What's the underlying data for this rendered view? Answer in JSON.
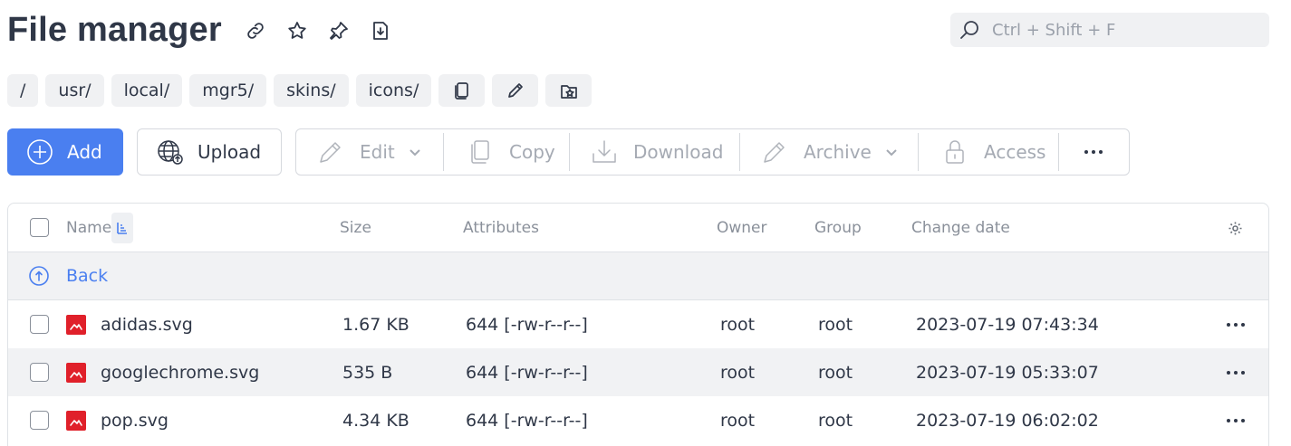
{
  "header": {
    "title": "File manager",
    "icons": [
      "link-icon",
      "star-icon",
      "pin-icon",
      "save-download-icon"
    ]
  },
  "search": {
    "placeholder": "Ctrl + Shift + F",
    "icon": "search-icon"
  },
  "breadcrumbs": [
    "/",
    "usr/",
    "local/",
    "mgr5/",
    "skins/",
    "icons/"
  ],
  "breadcrumb_actions": [
    "copy-path-icon",
    "edit-path-icon",
    "favorite-folder-icon"
  ],
  "toolbar": {
    "add_label": "Add",
    "upload_label": "Upload",
    "edit_label": "Edit",
    "copy_label": "Copy",
    "download_label": "Download",
    "archive_label": "Archive",
    "access_label": "Access"
  },
  "table": {
    "columns": [
      "Name",
      "Size",
      "Attributes",
      "Owner",
      "Group",
      "Change date"
    ],
    "back_label": "Back",
    "rows": [
      {
        "name": "adidas.svg",
        "size": "1.67 KB",
        "attributes": "644 [-rw-r--r--]",
        "owner": "root",
        "group": "root",
        "date": "2023-07-19 07:43:34"
      },
      {
        "name": "googlechrome.svg",
        "size": "535 B",
        "attributes": "644 [-rw-r--r--]",
        "owner": "root",
        "group": "root",
        "date": "2023-07-19 05:33:07"
      },
      {
        "name": "pop.svg",
        "size": "4.34 KB",
        "attributes": "644 [-rw-r--r--]",
        "owner": "root",
        "group": "root",
        "date": "2023-07-19 06:02:02"
      }
    ]
  },
  "colors": {
    "accent": "#4a7ff0",
    "file_icon": "#e0202a",
    "text": "#2f3747",
    "disabled": "#a5aab3"
  }
}
